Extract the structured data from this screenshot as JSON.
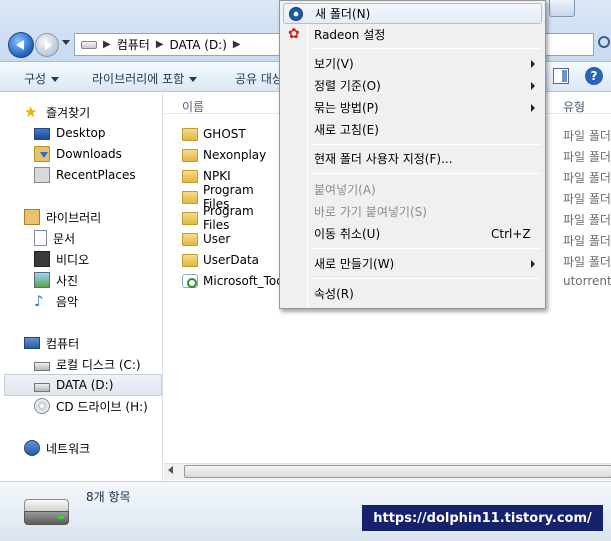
{
  "address": {
    "crumbs": [
      "컴퓨터",
      "DATA (D:)"
    ]
  },
  "toolbar": {
    "organize": "구성",
    "include_in_library": "라이브러리에 포함",
    "share": "공유 대상"
  },
  "navpane": {
    "favorites": "즐겨찾기",
    "desktop": "Desktop",
    "downloads": "Downloads",
    "recent_places": "RecentPlaces",
    "libraries": "라이브러리",
    "documents": "문서",
    "videos": "비디오",
    "pictures": "사진",
    "music": "음악",
    "computer": "컴퓨터",
    "local_disk": "로컬 디스크 (C:)",
    "data_drive": "DATA (D:)",
    "cd_drive": "CD 드라이브 (H:)",
    "network": "네트워크"
  },
  "filelist": {
    "col_name": "이름",
    "col_type": "유형",
    "items": [
      {
        "name": "GHOST",
        "type": "파일 폴더"
      },
      {
        "name": "Nexonplay",
        "type": "파일 폴더"
      },
      {
        "name": "NPKI",
        "type": "파일 폴더"
      },
      {
        "name": "Program Files",
        "type": "파일 폴더"
      },
      {
        "name": "Program Files",
        "type": "파일 폴더"
      },
      {
        "name": "User",
        "type": "파일 폴더"
      },
      {
        "name": "UserData",
        "type": "파일 폴더"
      },
      {
        "name": "Microsoft_Too",
        "type": "utorrent"
      }
    ]
  },
  "status": {
    "item_count": "8개 항목"
  },
  "watermark": "https://dolphin11.tistory.com/",
  "context_menu": {
    "new_folder": "새 폴더(N)",
    "radeon": "Radeon 설정",
    "view": "보기(V)",
    "sort_by": "정렬 기준(O)",
    "group_by": "묶는 방법(P)",
    "refresh": "새로 고침(E)",
    "customize": "현재 폴더 사용자 지정(F)...",
    "paste": "붙여넣기(A)",
    "paste_shortcut": "바로 가기 붙여넣기(S)",
    "undo_move": "이동 취소(U)",
    "undo_shortcut": "Ctrl+Z",
    "new": "새로 만들기(W)",
    "properties": "속성(R)"
  }
}
